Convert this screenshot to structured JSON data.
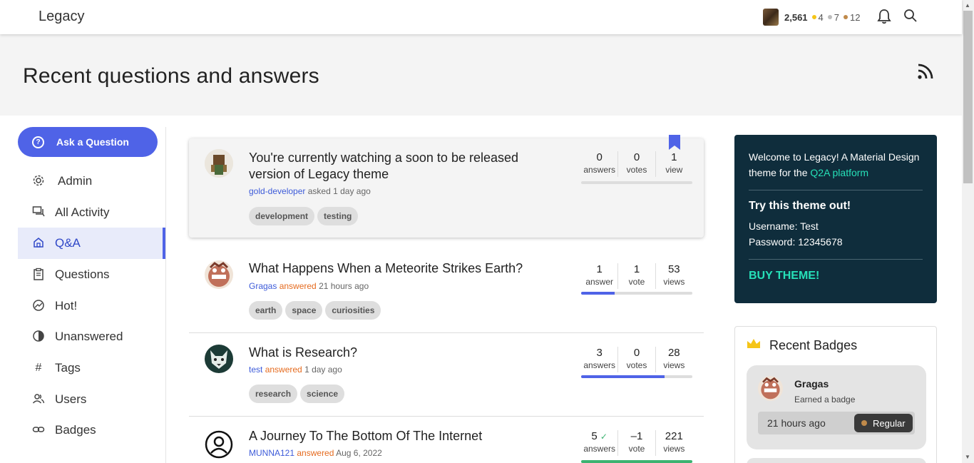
{
  "app": {
    "name": "Legacy",
    "points": "2,561",
    "badge_counts": [
      {
        "count": "4",
        "color": "#f5c518"
      },
      {
        "count": "7",
        "color": "#bdbdbd"
      },
      {
        "count": "12",
        "color": "#c08a4a"
      }
    ]
  },
  "page": {
    "title": "Recent questions and answers"
  },
  "sidebar": {
    "ask_label": "Ask a Question",
    "items": [
      {
        "label": "Admin",
        "icon": "gear-icon"
      },
      {
        "label": "All Activity",
        "icon": "forum-icon"
      },
      {
        "label": "Q&A",
        "icon": "home-icon"
      },
      {
        "label": "Questions",
        "icon": "clipboard-icon"
      },
      {
        "label": "Hot!",
        "icon": "trending-icon"
      },
      {
        "label": "Unanswered",
        "icon": "contrast-icon"
      },
      {
        "label": "Tags",
        "icon": "hash-icon"
      },
      {
        "label": "Users",
        "icon": "users-icon"
      },
      {
        "label": "Badges",
        "icon": "link-icon"
      }
    ]
  },
  "questions": [
    {
      "title_line1": "You're currently watching a soon to be released",
      "title_line2": "version of Legacy theme",
      "author": "gold-developer",
      "action": "asked",
      "when": "1 day ago",
      "tags": [
        "development",
        "testing"
      ],
      "answers": "0",
      "answers_label": "answers",
      "votes": "0",
      "votes_label": "votes",
      "views": "1",
      "views_label": "view",
      "progress": 0
    },
    {
      "title_line1": "What Happens When a Meteorite Strikes Earth?",
      "author": "Gragas",
      "action": "answered",
      "when": "21 hours ago",
      "tags": [
        "earth",
        "space",
        "curiosities"
      ],
      "answers": "1",
      "answers_label": "answer",
      "votes": "1",
      "votes_label": "vote",
      "views": "53",
      "views_label": "views",
      "progress": 0.3
    },
    {
      "title_line1": "What is Research?",
      "author": "test",
      "action": "answered",
      "when": "1 day ago",
      "tags": [
        "research",
        "science"
      ],
      "answers": "3",
      "answers_label": "answers",
      "votes": "0",
      "votes_label": "votes",
      "views": "28",
      "views_label": "views",
      "progress": 0.75
    },
    {
      "title_line1": "A Journey To The Bottom Of The Internet",
      "author": "MUNNA121",
      "action": "answered",
      "when": "Aug 6, 2022",
      "answers": "5",
      "answers_label": "answers",
      "votes": "–1",
      "votes_label": "vote",
      "views": "221",
      "views_label": "views",
      "progress": 1
    }
  ],
  "welcome": {
    "intro_text": "Welcome to Legacy! A Material Design theme for the",
    "intro_link": "Q2A platform",
    "try_title": "Try this theme out!",
    "username": "Username: Test",
    "password": "Password: 12345678",
    "buy_label": "BUY THEME!"
  },
  "recent_badges": {
    "title": "Recent Badges",
    "items": [
      {
        "user": "Gragas",
        "text": "Earned a badge",
        "time": "21 hours ago",
        "badge": "Regular",
        "badge_color": "#c08a4a"
      }
    ]
  }
}
